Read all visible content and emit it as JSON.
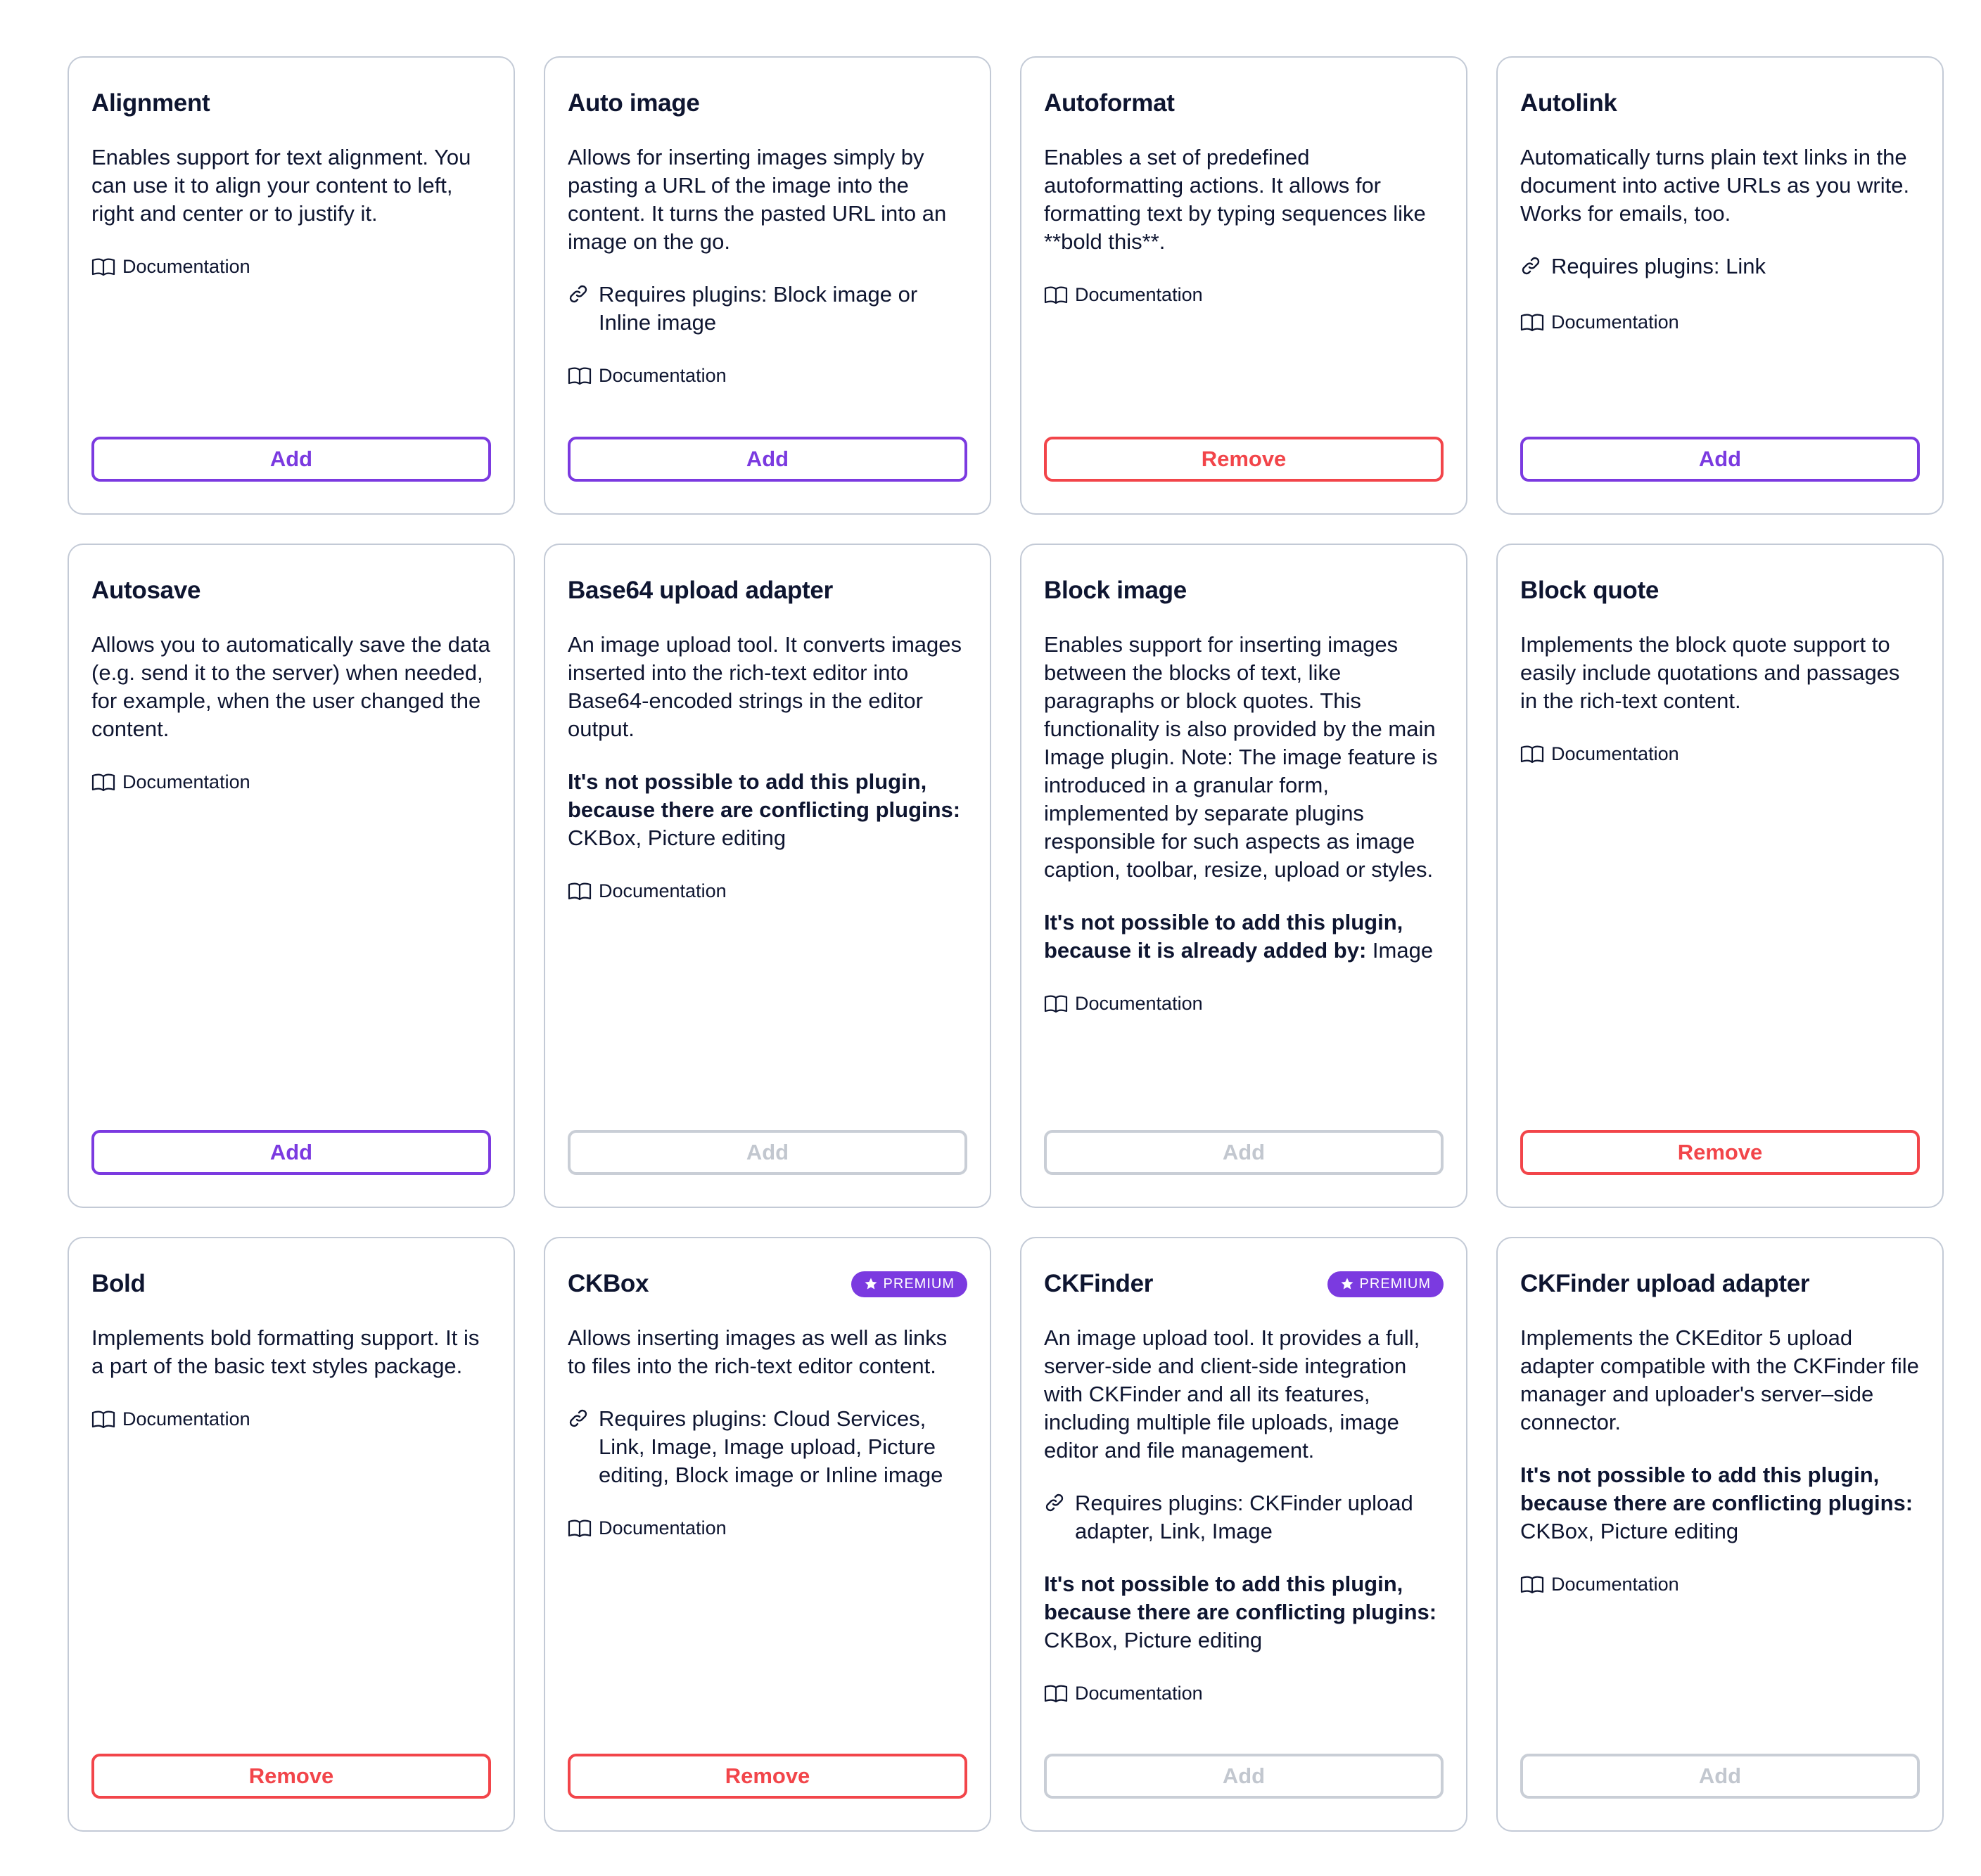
{
  "colors": {
    "accent": "#7b3ae0",
    "danger": "#f2454a",
    "disabled": "#c2c7cf",
    "card_border": "#c3cad6",
    "text": "#0e1530"
  },
  "doc_label": "Documentation",
  "premium_label": "PREMIUM",
  "cards": [
    {
      "title": "Alignment",
      "premium": false,
      "description": "Enables support for text alignment. You can use it to align your content to left, right and center or to justify it.",
      "requires": null,
      "conflict": null,
      "button": "Add",
      "button_state": "add"
    },
    {
      "title": "Auto image",
      "premium": false,
      "description": "Allows for inserting images simply by pasting a URL of the image into the content. It turns the pasted URL into an image on the go.",
      "requires": "Requires plugins: Block image or Inline image",
      "conflict": null,
      "button": "Add",
      "button_state": "add"
    },
    {
      "title": "Autoformat",
      "premium": false,
      "description": "Enables a set of predefined autoformatting actions. It allows for formatting text by typing sequences like **bold this**.",
      "requires": null,
      "conflict": null,
      "button": "Remove",
      "button_state": "remove"
    },
    {
      "title": "Autolink",
      "premium": false,
      "description": "Automatically turns plain text links in the document into active URLs as you write. Works for emails, too.",
      "requires": "Requires plugins: Link",
      "conflict": null,
      "button": "Add",
      "button_state": "add"
    },
    {
      "title": "Autosave",
      "premium": false,
      "description": "Allows you to automatically save the data (e.g. send it to the server) when needed, for example, when the user changed the content.",
      "requires": null,
      "conflict": null,
      "button": "Add",
      "button_state": "add"
    },
    {
      "title": "Base64 upload adapter",
      "premium": false,
      "description": "An image upload tool. It converts images inserted into the rich-text editor into Base64-encoded strings in the editor output.",
      "requires": null,
      "conflict": {
        "bold": "It's not possible to add this plugin, because there are conflicting plugins:",
        "rest": " CKBox, Picture editing"
      },
      "button": "Add",
      "button_state": "disabled"
    },
    {
      "title": "Block image",
      "premium": false,
      "description": "Enables support for inserting images between the blocks of text, like paragraphs or block quotes. This functionality is also provided by the main Image plugin. Note: The image feature is introduced in a granular form, implemented by separate plugins responsible for such aspects as image caption, toolbar, resize, upload or styles.",
      "requires": null,
      "conflict": {
        "bold": "It's not possible to add this plugin, because it is already added by:",
        "rest": " Image"
      },
      "button": "Add",
      "button_state": "disabled"
    },
    {
      "title": "Block quote",
      "premium": false,
      "description": "Implements the block quote support to easily include quotations and passages in the rich-text content.",
      "requires": null,
      "conflict": null,
      "button": "Remove",
      "button_state": "remove"
    },
    {
      "title": "Bold",
      "premium": false,
      "description": "Implements bold formatting support. It is a part of the basic text styles package.",
      "requires": null,
      "conflict": null,
      "button": "Remove",
      "button_state": "remove"
    },
    {
      "title": "CKBox",
      "premium": true,
      "description": "Allows inserting images as well as links to files into the rich-text editor content.",
      "requires": "Requires plugins: Cloud Services, Link, Image, Image upload, Picture editing, Block image or Inline image",
      "conflict": null,
      "button": "Remove",
      "button_state": "remove"
    },
    {
      "title": "CKFinder",
      "premium": true,
      "description": "An image upload tool. It provides a full, server-side and client-side integration with CKFinder and all its features, including multiple file uploads, image editor and file management.",
      "requires": "Requires plugins: CKFinder upload adapter, Link, Image",
      "conflict": {
        "bold": "It's not possible to add this plugin, because there are conflicting plugins:",
        "rest": " CKBox, Picture editing"
      },
      "button": "Add",
      "button_state": "disabled"
    },
    {
      "title": "CKFinder upload adapter",
      "premium": false,
      "description": "Implements the CKEditor 5 upload adapter compatible with the CKFinder file manager and uploader's server–side connector.",
      "requires": null,
      "conflict": {
        "bold": "It's not possible to add this plugin, because there are conflicting plugins:",
        "rest": " CKBox, Picture editing"
      },
      "button": "Add",
      "button_state": "disabled"
    }
  ]
}
